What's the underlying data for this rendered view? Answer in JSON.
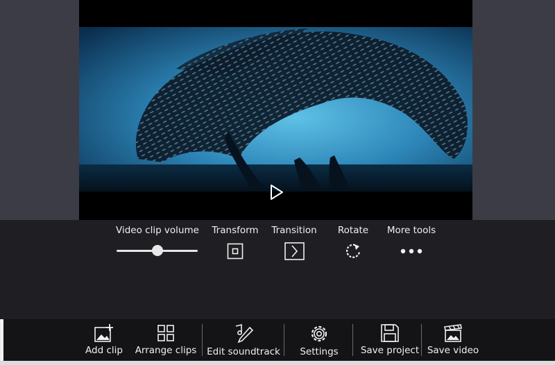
{
  "video_tools": {
    "volume_label": "Video clip volume",
    "volume_level": 0.5,
    "transform_label": "Transform",
    "transition_label": "Transition",
    "rotate_label": "Rotate",
    "more_tools_label": "More tools"
  },
  "toolbar": {
    "add_clip": "Add clip",
    "arrange_clips": "Arrange clips",
    "edit_soundtrack": "Edit soundtrack",
    "settings": "Settings",
    "save_project": "Save project",
    "save_video": "Save video"
  },
  "icons": {
    "play": "play-icon",
    "transform": "transform-icon",
    "transition": "transition-icon",
    "rotate": "rotate-icon",
    "more": "more-icon",
    "add_clip": "add-clip-icon",
    "arrange": "grid-icon",
    "soundtrack": "music-pen-icon",
    "settings": "gear-icon",
    "save_project": "floppy-icon",
    "save_video": "clapper-icon"
  },
  "colors": {
    "background": "#3b3b45",
    "panel": "#1f1f23",
    "toolbar": "#141417",
    "accent": "#f0f0f0"
  }
}
